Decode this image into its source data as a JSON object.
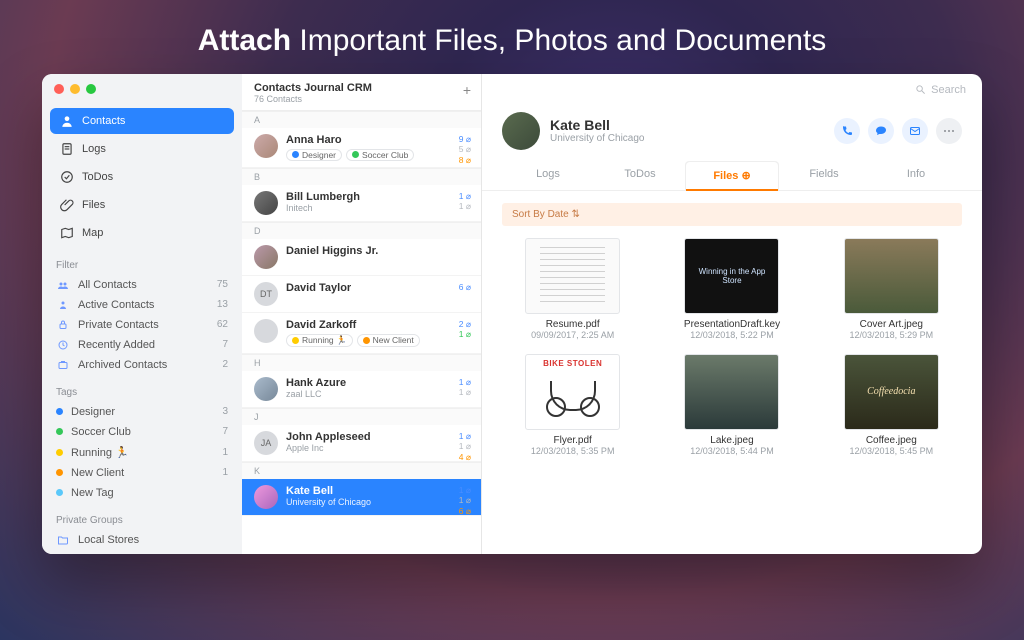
{
  "headline": {
    "bold": "Attach",
    "rest": " Important Files, Photos and Documents"
  },
  "sidebar": {
    "nav": [
      {
        "label": "Contacts",
        "icon": "person"
      },
      {
        "label": "Logs",
        "icon": "note"
      },
      {
        "label": "ToDos",
        "icon": "check"
      },
      {
        "label": "Files",
        "icon": "clip"
      },
      {
        "label": "Map",
        "icon": "map"
      }
    ],
    "filter_header": "Filter",
    "filters": [
      {
        "label": "All Contacts",
        "count": "75"
      },
      {
        "label": "Active Contacts",
        "count": "13"
      },
      {
        "label": "Private Contacts",
        "count": "62"
      },
      {
        "label": "Recently Added",
        "count": "7"
      },
      {
        "label": "Archived Contacts",
        "count": "2"
      }
    ],
    "tags_header": "Tags",
    "tags": [
      {
        "label": "Designer",
        "color": "blue",
        "count": "3"
      },
      {
        "label": "Soccer Club",
        "color": "green",
        "count": "7"
      },
      {
        "label": "Running 🏃",
        "color": "yellow",
        "count": "1"
      },
      {
        "label": "New Client",
        "color": "orange",
        "count": "1"
      },
      {
        "label": "New Tag",
        "color": "teal",
        "count": ""
      }
    ],
    "groups_header": "Private Groups",
    "groups": [
      {
        "label": "Local Stores"
      }
    ]
  },
  "mid": {
    "title": "Contacts Journal CRM",
    "subtitle": "76 Contacts",
    "sections": [
      {
        "letter": "A",
        "contacts": [
          {
            "name": "Anna Haro",
            "sub": "",
            "tags": [
              [
                "blue",
                "Designer"
              ],
              [
                "green",
                "Soccer Club"
              ]
            ],
            "counts": [
              [
                "9",
                "mc-blue"
              ],
              [
                "5",
                "mc-gray"
              ],
              [
                "8",
                "mc-orange"
              ]
            ]
          }
        ]
      },
      {
        "letter": "B",
        "contacts": [
          {
            "name": "Bill Lumbergh",
            "sub": "Initech",
            "tags": [],
            "counts": [
              [
                "1",
                "mc-blue"
              ],
              [
                "1",
                "mc-gray"
              ]
            ]
          }
        ]
      },
      {
        "letter": "D",
        "contacts": [
          {
            "name": "Daniel Higgins Jr.",
            "sub": "",
            "tags": [],
            "counts": []
          },
          {
            "name": "David Taylor",
            "sub": "",
            "initials": "DT",
            "tags": [],
            "counts": [
              [
                "6",
                "mc-blue"
              ]
            ]
          },
          {
            "name": "David Zarkoff",
            "sub": "",
            "tags": [
              [
                "yellow",
                "Running 🏃"
              ],
              [
                "orange",
                "New Client"
              ]
            ],
            "counts": [
              [
                "2",
                "mc-blue"
              ],
              [
                "1",
                "mc-green"
              ]
            ]
          }
        ]
      },
      {
        "letter": "H",
        "contacts": [
          {
            "name": "Hank Azure",
            "sub": "zaal LLC",
            "tags": [],
            "counts": [
              [
                "1",
                "mc-blue"
              ],
              [
                "1",
                "mc-gray"
              ]
            ]
          }
        ]
      },
      {
        "letter": "J",
        "contacts": [
          {
            "name": "John Appleseed",
            "sub": "Apple Inc",
            "initials": "JA",
            "tags": [],
            "counts": [
              [
                "1",
                "mc-blue"
              ],
              [
                "1",
                "mc-gray"
              ],
              [
                "4",
                "mc-orange"
              ]
            ]
          }
        ]
      },
      {
        "letter": "K",
        "contacts": [
          {
            "name": "Kate Bell",
            "sub": "University of Chicago",
            "selected": true,
            "tags": [],
            "counts": [
              [
                "1",
                "mc-blue"
              ],
              [
                "1",
                "mc-gray"
              ],
              [
                "6",
                "mc-orange"
              ]
            ]
          }
        ]
      }
    ]
  },
  "detail": {
    "search_placeholder": "Search",
    "name": "Kate Bell",
    "sub": "University of Chicago",
    "tabs": [
      "Logs",
      "ToDos",
      "Files ⊕",
      "Fields",
      "Info"
    ],
    "active_tab_index": 2,
    "sort_label": "Sort By Date ⇅",
    "files": [
      {
        "name": "Resume.pdf",
        "date": "09/09/2017, 2:25 AM",
        "kind": "doc"
      },
      {
        "name": "PresentationDraft.key",
        "date": "12/03/2018, 5:22 PM",
        "kind": "key",
        "keytext": "Winning in the App Store"
      },
      {
        "name": "Cover Art.jpeg",
        "date": "12/03/2018, 5:29 PM",
        "kind": "photo1"
      },
      {
        "name": "Flyer.pdf",
        "date": "12/03/2018, 5:35 PM",
        "kind": "flyer",
        "flyertext": "BIKE STOLEN"
      },
      {
        "name": "Lake.jpeg",
        "date": "12/03/2018, 5:44 PM",
        "kind": "photo2"
      },
      {
        "name": "Coffee.jpeg",
        "date": "12/03/2018, 5:45 PM",
        "kind": "photo3",
        "phototext": "Coffeedocia"
      }
    ]
  }
}
